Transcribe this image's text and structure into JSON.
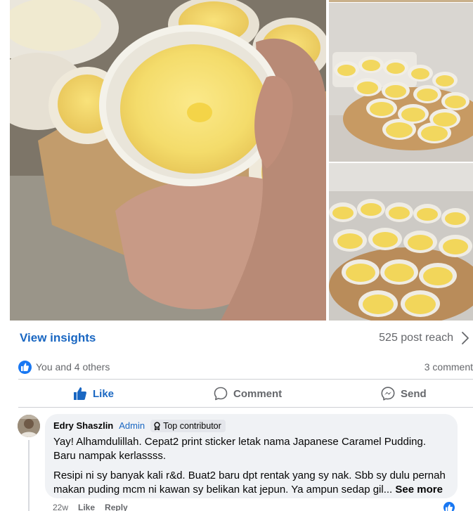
{
  "post": {
    "insights_link": "View insights",
    "reach": "525 post reach",
    "reactions_summary": "You and 4 others",
    "comments_count": "3 comment"
  },
  "actions": {
    "like": "Like",
    "comment": "Comment",
    "send": "Send"
  },
  "comment": {
    "author": "Edry Shaszlin",
    "role_badge": "Admin",
    "contributor_badge": "Top contributor",
    "paragraph1": "Yay! Alhamdulillah. Cepat2 print sticker letak nama Japanese Caramel Pudding. Baru nampak kerlassss.",
    "paragraph2": "Resipi ni sy banyak kali r&d. Buat2 baru dpt rentak yang sy nak. Sbb sy dulu pernah makan puding mcm ni kawan sy belikan kat jepun. Ya ampun sedap gil...",
    "see_more": "See more",
    "time": "22w",
    "like_action": "Like",
    "reply_action": "Reply"
  },
  "colors": {
    "accent": "#1a67c2",
    "like_blue": "#1877f2",
    "muted": "#65676b",
    "bubble_bg": "#f0f2f5",
    "pudding_yellow": "#f3dc6a"
  },
  "icons": {
    "chevron": "chevron-right-icon",
    "like_badge": "thumbs-up-icon",
    "like": "thumbs-up-icon",
    "comment": "speech-bubble-icon",
    "send": "messenger-icon",
    "contributor": "badge-icon"
  }
}
